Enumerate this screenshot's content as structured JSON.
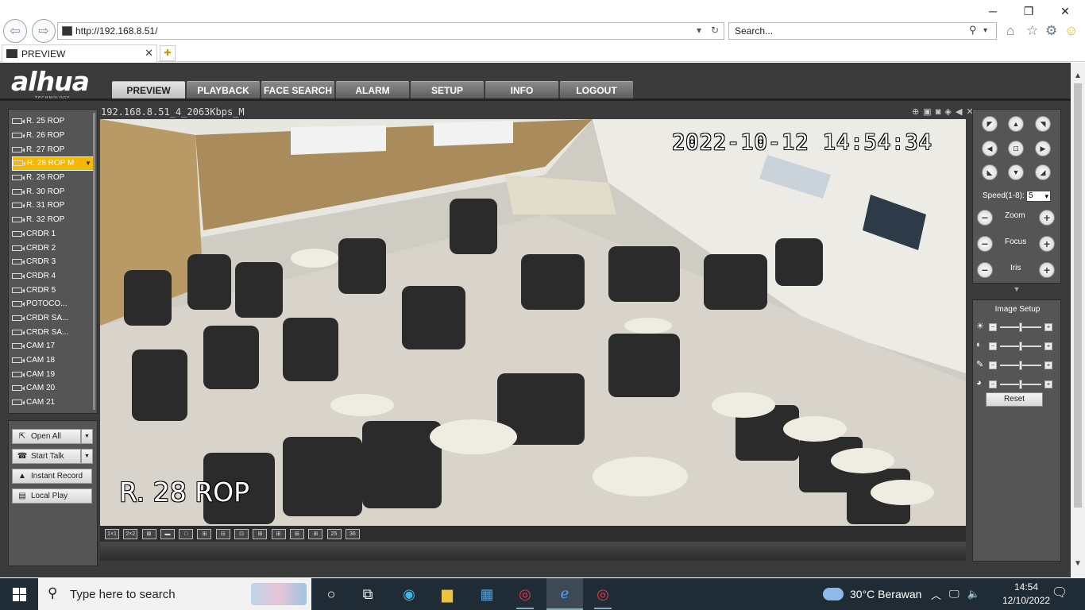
{
  "browser": {
    "url": "http://192.168.8.51/",
    "search_placeholder": "Search...",
    "tab_title": "PREVIEW",
    "tab_close": "✕"
  },
  "app": {
    "logo": "alhua",
    "logo_sub": "TECHNOLOGY",
    "menu": [
      {
        "label": "PREVIEW",
        "active": true
      },
      {
        "label": "PLAYBACK"
      },
      {
        "label": "FACE SEARCH"
      },
      {
        "label": "ALARM"
      },
      {
        "label": "SETUP"
      },
      {
        "label": "INFO"
      },
      {
        "label": "LOGOUT"
      }
    ],
    "channels": [
      {
        "label": "R. 25 ROP"
      },
      {
        "label": "R. 26 ROP"
      },
      {
        "label": "R. 27 ROP"
      },
      {
        "label": "R. 28 ROP   M",
        "selected": true
      },
      {
        "label": "R. 29 ROP"
      },
      {
        "label": "R. 30 ROP"
      },
      {
        "label": "R. 31 ROP"
      },
      {
        "label": "R. 32 ROP"
      },
      {
        "label": "CRDR 1"
      },
      {
        "label": "CRDR 2"
      },
      {
        "label": "CRDR 3"
      },
      {
        "label": "CRDR 4"
      },
      {
        "label": "CRDR 5"
      },
      {
        "label": "POTOCO..."
      },
      {
        "label": "CRDR SA..."
      },
      {
        "label": "CRDR SA..."
      },
      {
        "label": "CAM 17"
      },
      {
        "label": "CAM 18"
      },
      {
        "label": "CAM 19"
      },
      {
        "label": "CAM 20"
      },
      {
        "label": "CAM 21"
      }
    ],
    "controls": {
      "open_all": "Open All",
      "start_talk": "Start Talk",
      "instant_record": "Instant Record",
      "local_play": "Local Play"
    },
    "video": {
      "title": "192.168.8.51_4_2063Kbps_M",
      "timestamp": "2022-10-12 14:54:34",
      "channel_name": "R. 28 ROP",
      "toolbar_icons": "⊕ ▣ ◙ ◈ ◀ ✕"
    },
    "layout_buttons": [
      "1×1",
      "2×2",
      "⊠",
      "▬",
      "□",
      "⊞",
      "⊟",
      "⊡",
      "⊞",
      "⊞",
      "⊞",
      "⊞",
      "25",
      "36"
    ],
    "ptz": {
      "speed_label": "Speed(1-8):",
      "speed_value": "5",
      "zoom_label": "Zoom",
      "focus_label": "Focus",
      "iris_label": "Iris"
    },
    "image_setup": {
      "title": "Image Setup",
      "reset": "Reset",
      "sliders": [
        {
          "icon": "brightness-icon",
          "value": 0.5
        },
        {
          "icon": "contrast-icon",
          "value": 0.5
        },
        {
          "icon": "saturation-icon",
          "value": 0.5
        },
        {
          "icon": "hue-icon",
          "value": 0.5
        }
      ]
    }
  },
  "taskbar": {
    "search_placeholder": "Type here to search",
    "weather": "30°C  Berawan",
    "time": "14:54",
    "date": "12/10/2022"
  }
}
